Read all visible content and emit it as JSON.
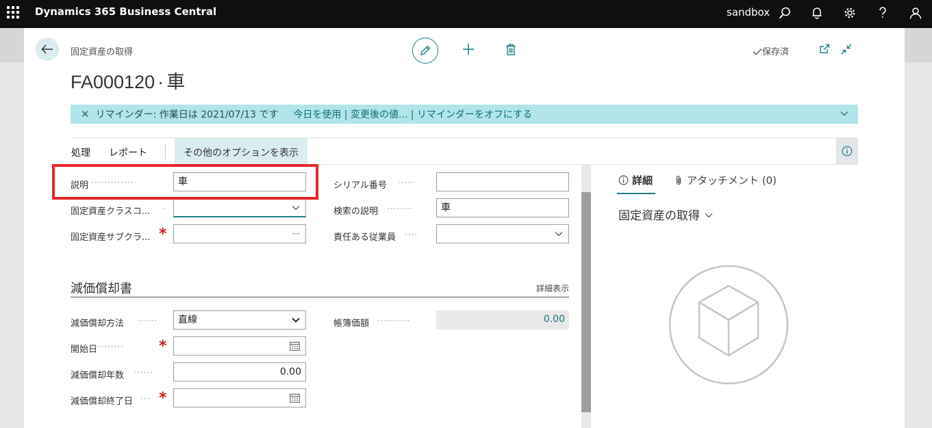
{
  "app": {
    "title": "Dynamics 365 Business Central",
    "environment": "sandbox"
  },
  "page": {
    "breadcrumb": "固定資産の取得",
    "record_no": "FA000120",
    "separator": "·",
    "record_name": "車",
    "saved_status": "保存済"
  },
  "reminder": {
    "close_glyph": "✕",
    "text": "リマインダー: 作業日は 2021/07/13 です",
    "links": "今日を使用 | 変更後の値... | リマインダーをオフにする"
  },
  "actions": {
    "process": "処理",
    "report": "レポート",
    "more_options": "その他のオプションを表示"
  },
  "general": {
    "description": {
      "label": "説明",
      "value": "車"
    },
    "class_code": {
      "label": "固定資産クラスコ...",
      "value": ""
    },
    "subclass": {
      "label": "固定資産サブクラ...",
      "value": "",
      "button": "···"
    },
    "serial_no": {
      "label": "シリアル番号",
      "value": ""
    },
    "search_desc": {
      "label": "検索の説明",
      "value": "車"
    },
    "employee": {
      "label": "責任ある従業員",
      "value": ""
    }
  },
  "depreciation": {
    "title": "減価償却書",
    "show_more": "詳細表示",
    "method": {
      "label": "減価償却方法",
      "value": "直線"
    },
    "start_date": {
      "label": "開始日",
      "value": ""
    },
    "years": {
      "label": "減価償却年数",
      "value": "0.00"
    },
    "end_date": {
      "label": "減価償却終了日",
      "value": ""
    },
    "book_value": {
      "label": "帳簿価額",
      "value": "0.00"
    }
  },
  "factbox": {
    "tab_details": "詳細",
    "tab_attachments": "アタッチメント (0)",
    "title": "固定資産の取得"
  },
  "colors": {
    "accent": "#1b7f84",
    "reminder_bg": "#b1e5ea",
    "highlight": "#e8242a",
    "required": "#d32020"
  }
}
